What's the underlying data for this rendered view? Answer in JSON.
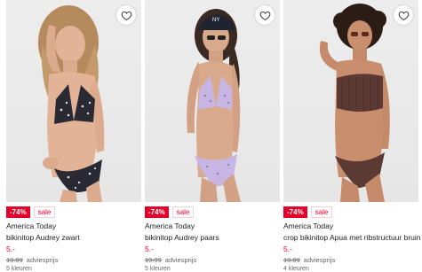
{
  "products": [
    {
      "discount": "-74%",
      "sale_label": "sale",
      "brand": "America Today",
      "name": "bikinitop Audrey zwart",
      "price": "5.-",
      "old_price": "19.99",
      "advice_label": "adviesprijs",
      "colors": "5 kleuren",
      "photo_desc": "model-black-floral-bikini",
      "swimsuit_color": "#2a2a35"
    },
    {
      "discount": "-74%",
      "sale_label": "sale",
      "brand": "America Today",
      "name": "bikinitop Audrey paars",
      "price": "5.-",
      "old_price": "19.99",
      "advice_label": "adviesprijs",
      "colors": "5 kleuren",
      "photo_desc": "model-lilac-floral-bikini-cap",
      "swimsuit_color": "#c7b6e3"
    },
    {
      "discount": "-74%",
      "sale_label": "sale",
      "brand": "America Today",
      "name": "crop bikinitop Apua met ribstructuur bruin",
      "price": "5.-",
      "old_price": "19.99",
      "advice_label": "adviesprijs",
      "colors": "4 kleuren",
      "photo_desc": "model-brown-ribbed-bikini",
      "swimsuit_color": "#5a3a33"
    }
  ],
  "colors": {
    "accent": "#e3002b",
    "photo_bg": "#e8e8e8"
  },
  "icons": {
    "favorite": "heart-outline-icon"
  }
}
